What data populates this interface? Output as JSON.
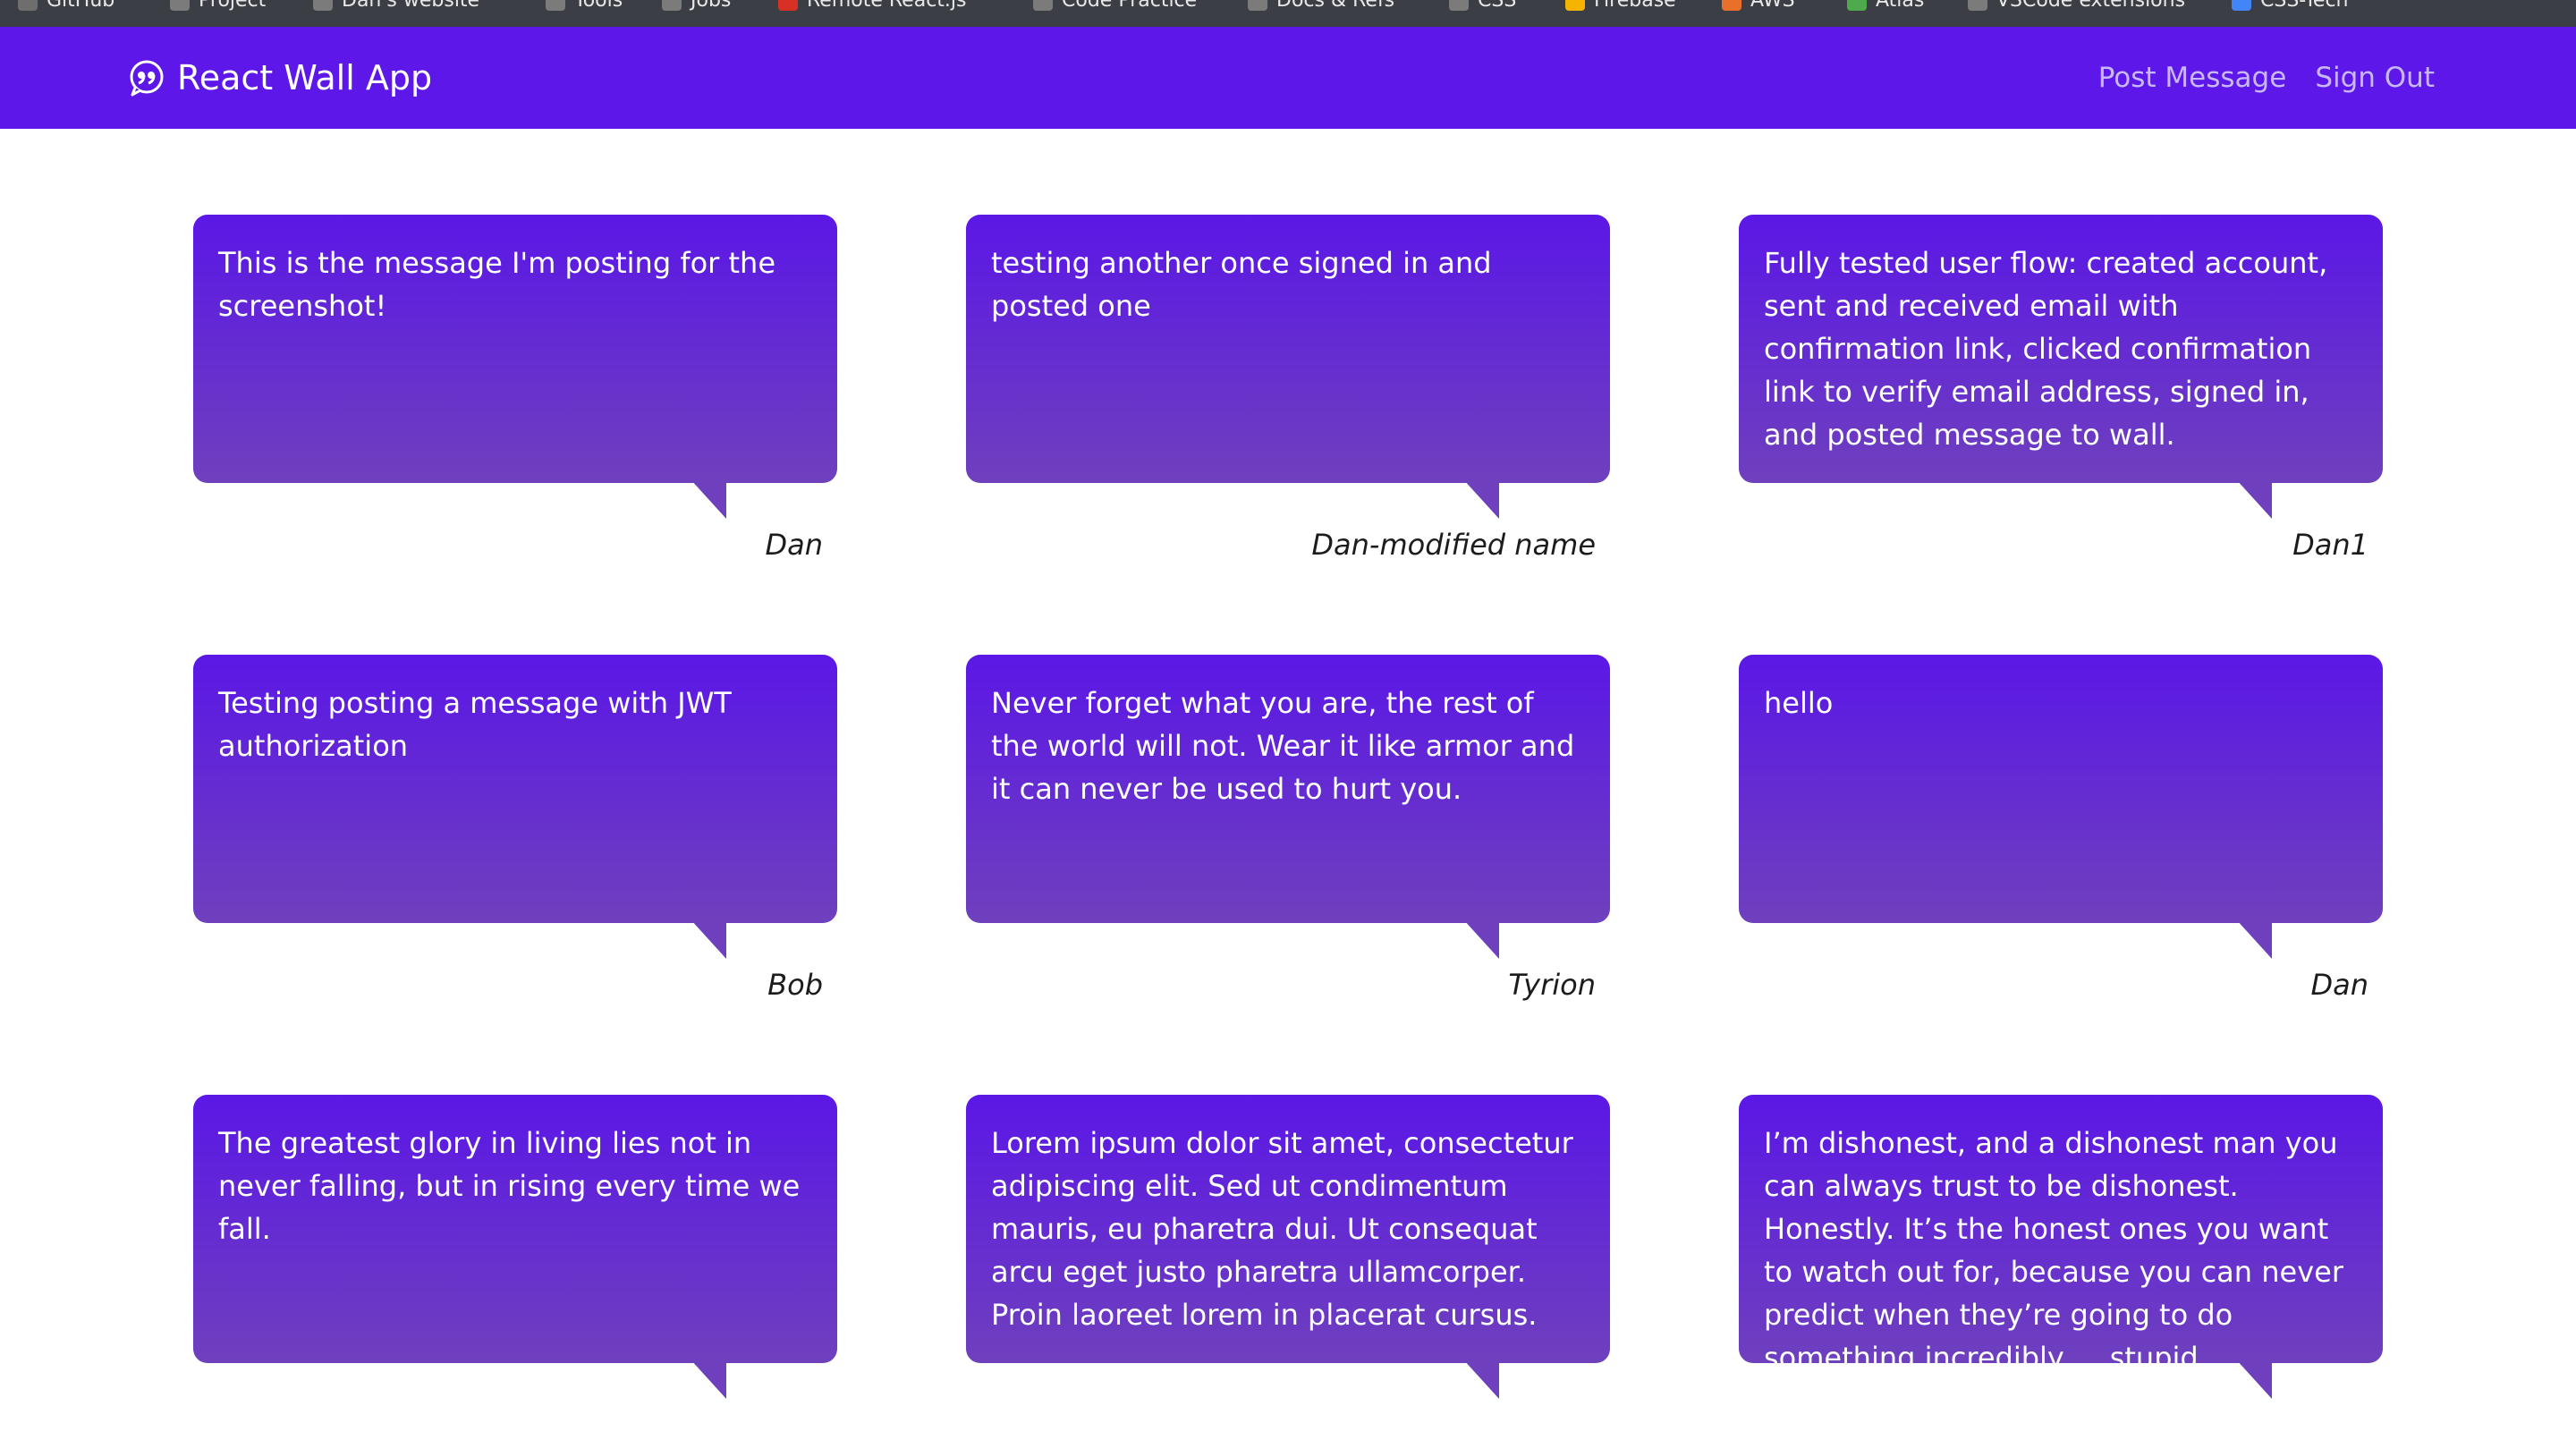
{
  "bookmarks": [
    {
      "label": "GitHub",
      "icon": "github-icon",
      "color": "#6e6e6e"
    },
    {
      "label": "Project",
      "icon": "folder-icon",
      "color": "#7b7b7b"
    },
    {
      "label": "Dan's website",
      "icon": "folder-icon",
      "color": "#7b7b7b"
    },
    {
      "label": "Tools",
      "icon": "folder-icon",
      "color": "#7b7b7b"
    },
    {
      "label": "Jobs",
      "icon": "folder-icon",
      "color": "#7b7b7b"
    },
    {
      "label": "Remote React.js",
      "icon": "remote-icon",
      "color": "#d93025"
    },
    {
      "label": "Code Practice",
      "icon": "folder-icon",
      "color": "#7b7b7b"
    },
    {
      "label": "Docs & Refs",
      "icon": "folder-icon",
      "color": "#7b7b7b"
    },
    {
      "label": "CSS",
      "icon": "folder-icon",
      "color": "#7b7b7b"
    },
    {
      "label": "Firebase",
      "icon": "firebase-icon",
      "color": "#f5b400"
    },
    {
      "label": "AWS",
      "icon": "aws-icon",
      "color": "#e8702a"
    },
    {
      "label": "Atlas",
      "icon": "mongodb-icon",
      "color": "#4fa94d"
    },
    {
      "label": "VSCode extensions",
      "icon": "folder-icon",
      "color": "#7b7b7b"
    },
    {
      "label": "CSS-Tech",
      "icon": "css-tech-icon",
      "color": "#4285f4"
    }
  ],
  "navbar": {
    "brand": "React Wall App",
    "brand_icon": "quote-bubble-icon",
    "links": [
      "Post Message",
      "Sign Out"
    ]
  },
  "colors": {
    "navbar": "#5d17e8",
    "bubble_top": "#5b17e6",
    "bubble_bottom": "#6e40bd",
    "nav_link": "#c9b8f7"
  },
  "messages": [
    {
      "text": "This is the message I'm posting for the screenshot!",
      "author": "Dan"
    },
    {
      "text": "testing another once signed in and posted one",
      "author": "Dan-modified name"
    },
    {
      "text": "Fully tested user flow: created account, sent and received email with confirmation link, clicked confirmation link to verify email address, signed in, and posted message to wall.",
      "author": "Dan1"
    },
    {
      "text": "Testing posting a message with JWT authorization",
      "author": "Bob"
    },
    {
      "text": "Never forget what you are, the rest of the world will not. Wear it like armor and it can never be used to hurt you.",
      "author": "Tyrion"
    },
    {
      "text": "hello",
      "author": "Dan"
    },
    {
      "text": "The greatest glory in living lies not in never falling, but in rising every time we fall.",
      "author": ""
    },
    {
      "text": "Lorem ipsum dolor sit amet, consectetur adipiscing elit. Sed ut condimentum mauris, eu pharetra dui. Ut consequat arcu eget justo pharetra ullamcorper. Proin laoreet lorem in placerat cursus.",
      "author": ""
    },
    {
      "text": "I’m dishonest, and a dishonest man you can always trust to be dishonest. Honestly. It’s the honest ones you want to watch out for, because you can never predict when they’re going to do something incredibly ... stupid.",
      "author": ""
    }
  ]
}
